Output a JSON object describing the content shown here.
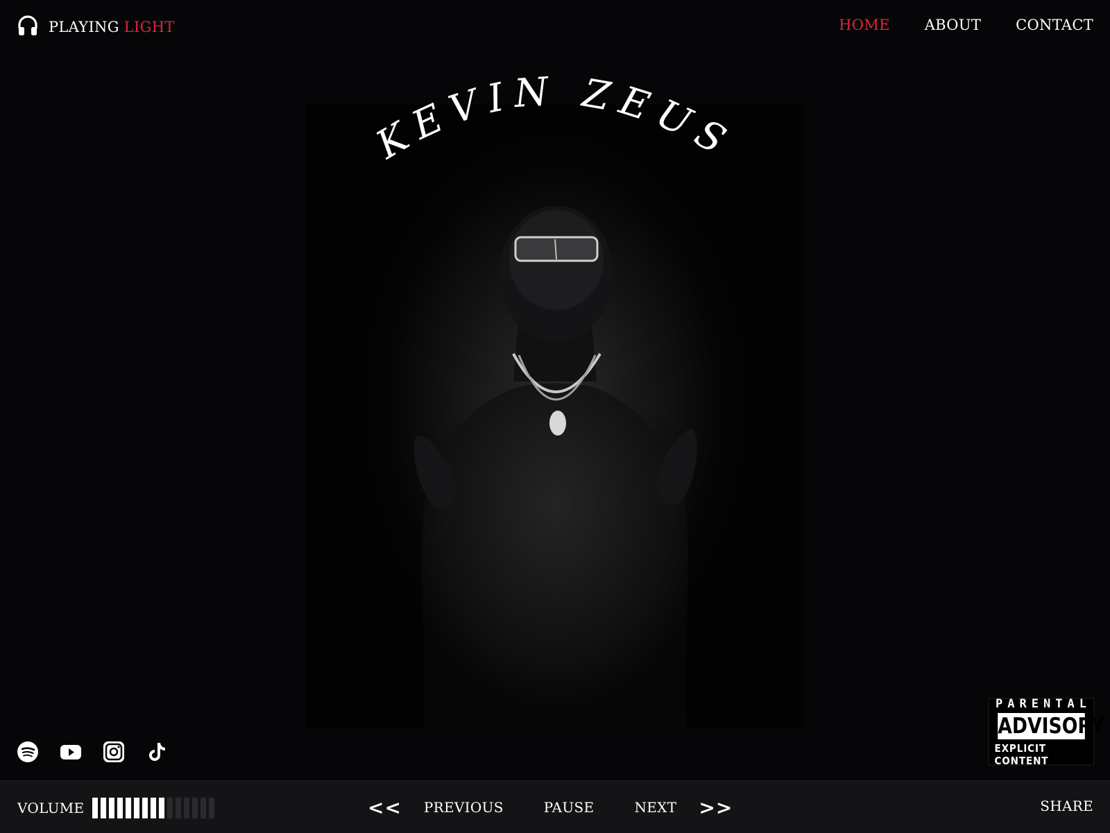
{
  "header": {
    "logo_prefix": "PLAYING",
    "logo_track": "LIGHT",
    "logo_icon": "headphones-icon",
    "nav": [
      {
        "label": "HOME",
        "active": true
      },
      {
        "label": "ABOUT",
        "active": false
      },
      {
        "label": "CONTACT",
        "active": false
      }
    ]
  },
  "hero": {
    "artist_name": "KEVIN ZEUS"
  },
  "advisory": {
    "line1": "PARENTAL",
    "line2": "ADVISORY",
    "line3": "EXPLICIT CONTENT"
  },
  "socials": [
    "spotify-icon",
    "youtube-icon",
    "instagram-icon",
    "tiktok-icon"
  ],
  "player": {
    "volume_label": "VOLUME",
    "volume_level": 0.6,
    "volume_segments": 15,
    "prev_arrows": "<<",
    "previous_label": "PREVIOUS",
    "pause_label": "PAUSE",
    "next_label": "NEXT",
    "next_arrows": ">>",
    "share_label": "SHARE"
  },
  "colors": {
    "background": "#060608",
    "accent": "#e0243a",
    "playerbar": "#141416"
  }
}
